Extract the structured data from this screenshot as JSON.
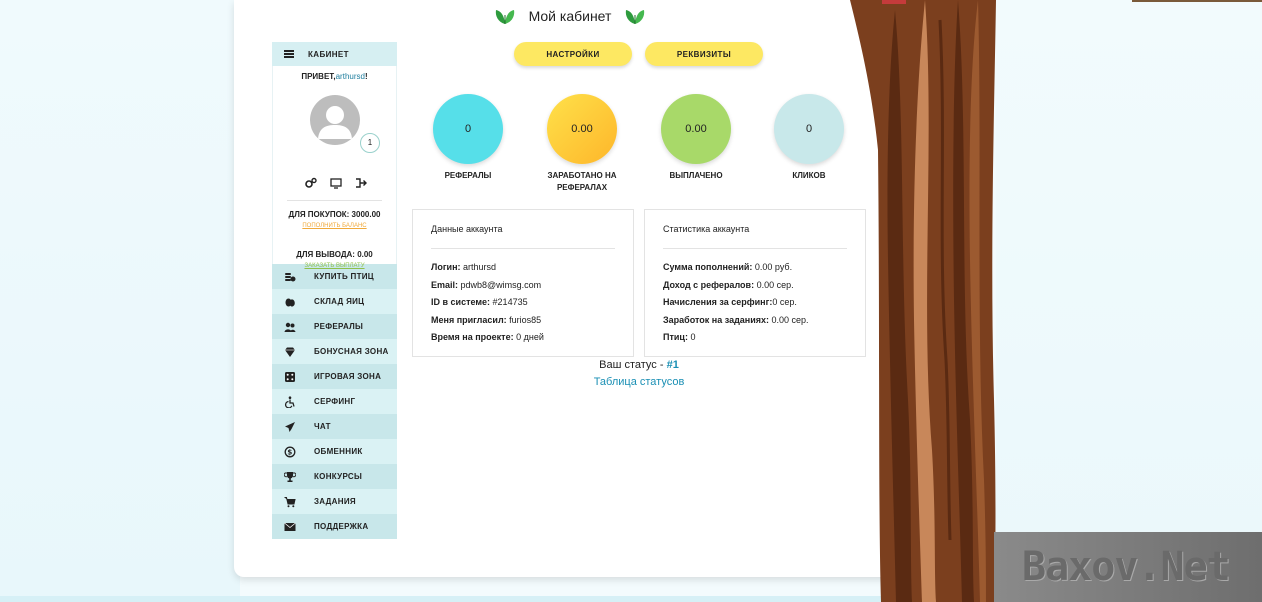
{
  "header": {
    "title": "Мой кабинет"
  },
  "sidebar": {
    "head_label": "КАБИНЕТ",
    "greeting": "ПРИВЕТ,",
    "username": "arthursd",
    "greeting_suffix": "!",
    "badge": "1",
    "purchase_balance": "ДЛЯ ПОКУПОК: 3000.00",
    "topup_link": "ПОПОЛНИТЬ БАЛАНС",
    "withdraw_balance": "ДЛЯ ВЫВОДА: 0.00",
    "payout_link": "ЗАКАЗАТЬ ВЫПЛАТУ",
    "menu": [
      {
        "label": "КУПИТЬ ПТИЦ",
        "icon": "coins-icon"
      },
      {
        "label": "СКЛАД ЯИЦ",
        "icon": "eggs-icon"
      },
      {
        "label": "РЕФЕРАЛЫ",
        "icon": "users-icon"
      },
      {
        "label": "БОНУСНАЯ ЗОНА",
        "icon": "diamond-icon"
      },
      {
        "label": "ИГРОВАЯ ЗОНА",
        "icon": "dice-icon"
      },
      {
        "label": "СЕРФИНГ",
        "icon": "accessible-icon"
      },
      {
        "label": "ЧАТ",
        "icon": "paper-plane-icon"
      },
      {
        "label": "ОБМЕННИК",
        "icon": "exchange-icon"
      },
      {
        "label": "КОНКУРСЫ",
        "icon": "trophy-icon"
      },
      {
        "label": "ЗАДАНИЯ",
        "icon": "cart-icon"
      },
      {
        "label": "ПОДДЕРЖКА",
        "icon": "envelope-icon"
      }
    ]
  },
  "buttons": {
    "settings": "НАСТРОЙКИ",
    "requisites": "РЕКВИЗИТЫ"
  },
  "stats": [
    {
      "value": "0",
      "label": "РЕФЕРАЛЫ",
      "color": "#56dfe9"
    },
    {
      "value": "0.00",
      "label": "ЗАРАБОТАНО НА РЕФЕРАЛАХ",
      "color": "#fdc93a"
    },
    {
      "value": "0.00",
      "label": "ВЫПЛАЧЕНО",
      "color": "#a8d969"
    },
    {
      "value": "0",
      "label": "КЛИКОВ",
      "color": "#c8e8ea"
    }
  ],
  "account": {
    "title": "Данные аккаунта",
    "rows": [
      {
        "label": "Логин:",
        "value": " arthursd"
      },
      {
        "label": "Email:",
        "value": " pdwb8@wimsg.com"
      },
      {
        "label": "ID в системе:",
        "value": " #214735"
      },
      {
        "label": "Меня пригласил:",
        "value": " furios85"
      },
      {
        "label": "Время на проекте:",
        "value": " 0 дней"
      }
    ]
  },
  "statistics": {
    "title": "Статистика аккаунта",
    "rows": [
      {
        "label": "Сумма пополнений:",
        "value": " 0.00 руб."
      },
      {
        "label": "Доход с рефералов:",
        "value": " 0.00 сер."
      },
      {
        "label": "Начисления за серфинг:",
        "value": "0 сер."
      },
      {
        "label": "Заработок на заданиях:",
        "value": " 0.00 сер."
      },
      {
        "label": "Птиц:",
        "value": " 0"
      }
    ]
  },
  "status": {
    "prefix": "Ваш статус - ",
    "value": "#1",
    "table_link": "Таблица статусов"
  },
  "watermark": "Baxov.Net"
}
